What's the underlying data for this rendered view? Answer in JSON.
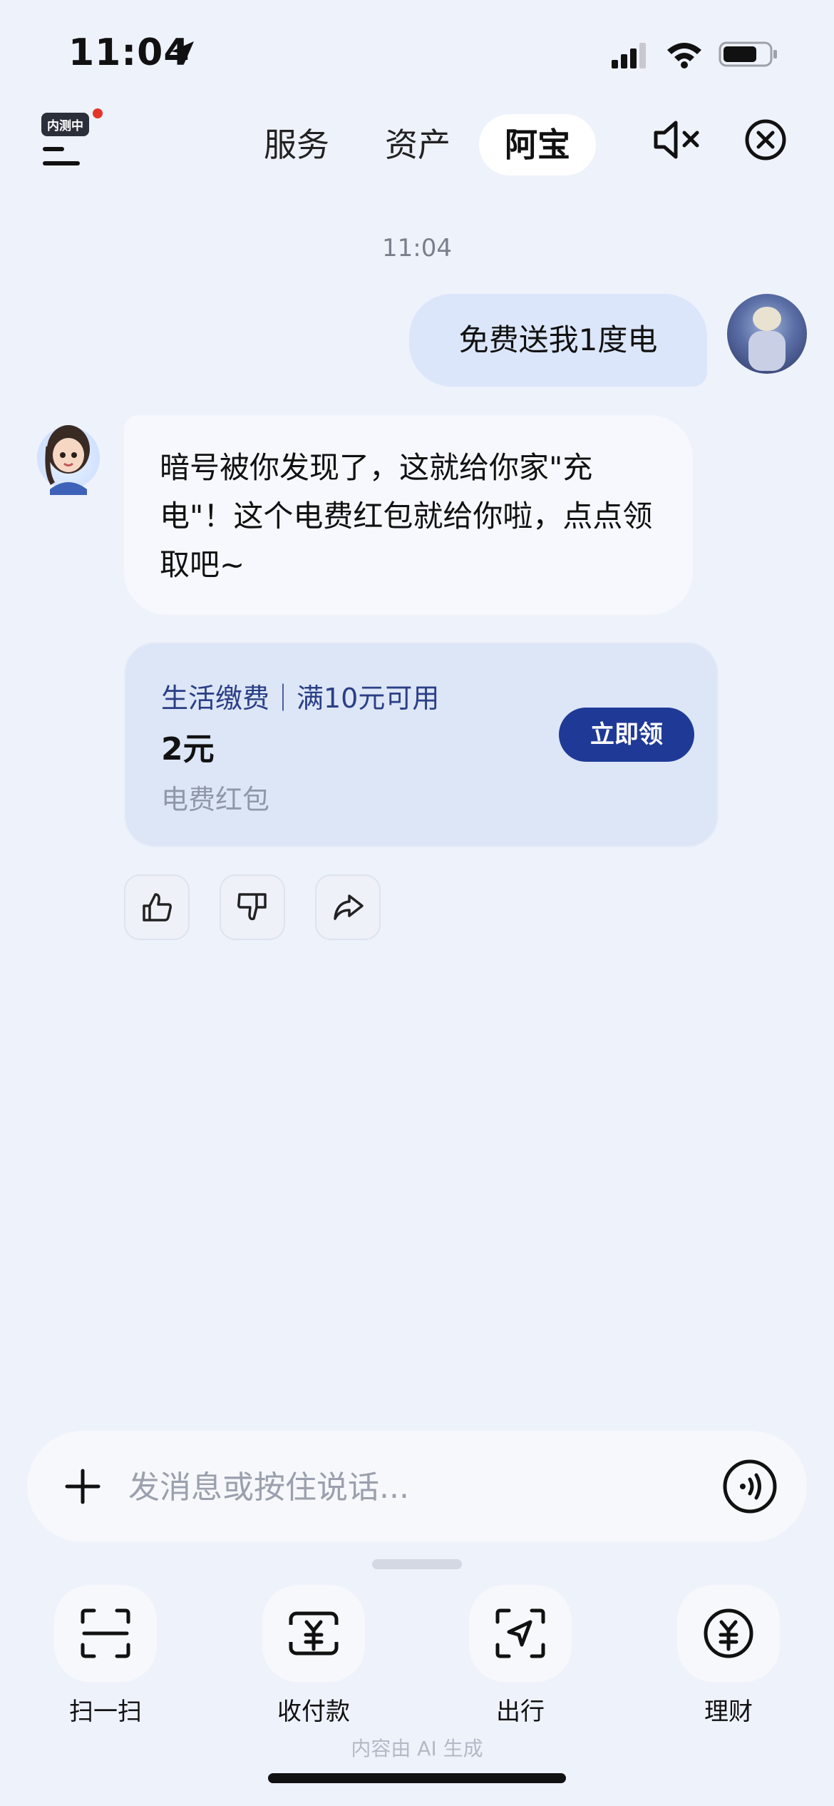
{
  "status_bar": {
    "time": "11:04"
  },
  "top_nav": {
    "beta_badge": "内测中",
    "tabs": [
      {
        "label": "服务"
      },
      {
        "label": "资产"
      },
      {
        "label": "阿宝",
        "active": true
      }
    ]
  },
  "chat": {
    "timestamp": "11:04",
    "user_message": "免费送我1度电",
    "bot_message": "暗号被你发现了，这就给你家\"充电\"！这个电费红包就给你啦，点点领取吧~",
    "coupon": {
      "tag": "生活缴费｜满10元可用",
      "amount": "2元",
      "name": "电费红包",
      "button_label": "立即领"
    }
  },
  "input": {
    "placeholder": "发消息或按住说话..."
  },
  "quick_actions": [
    {
      "label": "扫一扫",
      "icon": "scan-icon"
    },
    {
      "label": "收付款",
      "icon": "payment-icon"
    },
    {
      "label": "出行",
      "icon": "travel-icon"
    },
    {
      "label": "理财",
      "icon": "finance-icon"
    }
  ],
  "footer_note": "内容由 AI 生成",
  "colors": {
    "background": "#eef2fb",
    "accent": "#1f3a96",
    "user_bubble": "#dce6fa"
  }
}
